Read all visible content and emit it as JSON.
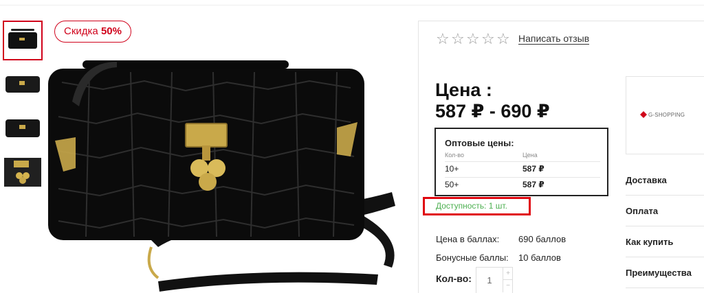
{
  "discount": {
    "prefix": "Скидка",
    "value": "50%"
  },
  "thumbnails": [
    "thumbnail-1",
    "thumbnail-2",
    "thumbnail-3",
    "thumbnail-4"
  ],
  "rating": {
    "stars": 0,
    "max": 5,
    "review_link": "Написать отзыв"
  },
  "price": {
    "title": "Цена :",
    "range": "587 ₽ - 690 ₽"
  },
  "wholesale": {
    "title": "Оптовые цены:",
    "columns": [
      "Кол-во",
      "Цена"
    ],
    "rows": [
      {
        "qty": "10+",
        "price": "587 ₽"
      },
      {
        "qty": "50+",
        "price": "587 ₽"
      }
    ]
  },
  "availability": "Доступность: 1 шт.",
  "points": [
    {
      "label": "Цена в баллах:",
      "value": "690 баллов"
    },
    {
      "label": "Бонусные баллы:",
      "value": "10 баллов"
    }
  ],
  "quantity": {
    "label": "Кол-во:",
    "value": "1"
  },
  "brand": {
    "name": "G-SHOPPING",
    "color": "#d0021b"
  },
  "side_menu": [
    "Доставка",
    "Оплата",
    "Как купить",
    "Преимущества"
  ],
  "colors": {
    "accent": "#d0021b",
    "available": "#4caf50",
    "highlight": "#e0060f"
  }
}
